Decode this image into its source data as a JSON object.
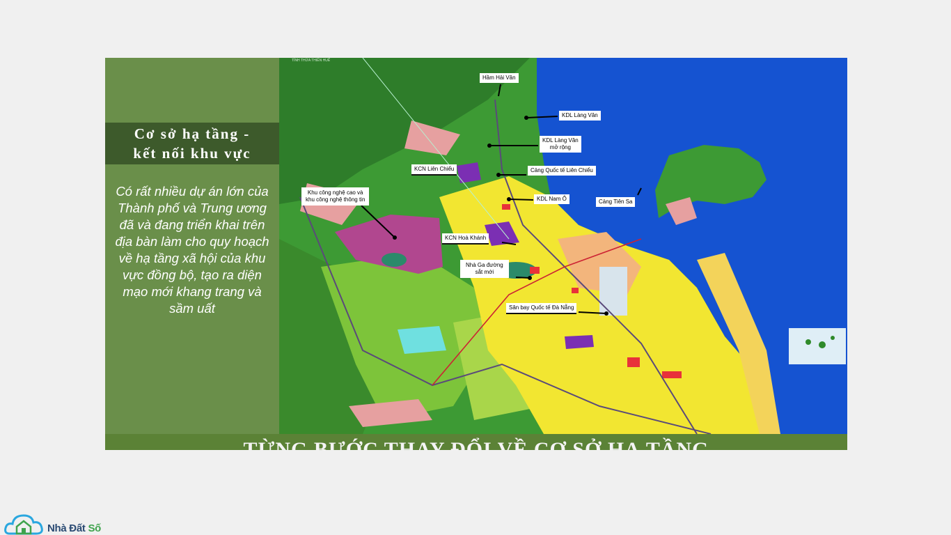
{
  "slide": {
    "title_line1": "Cơ sở hạ tầng -",
    "title_line2": "kết nối khu vực",
    "body": "Có rất nhiều dự án lớn của Thành phố và Trung ương đã và đang triển khai trên địa bàn làm cho quy hoạch về hạ tầng xã hội của khu vực đồng bộ, tạo ra diện mạo mới khang trang và sầm uất",
    "banner": "TỪNG BƯỚC THAY ĐỔI VỀ CƠ SỞ HẠ TẦNG"
  },
  "map": {
    "top_caption": "TỈNH THỪA THIÊN HUẾ",
    "labels": {
      "ham_hai_van": "Hầm Hải Vân",
      "kdl_lang_van": "KDL Làng Vân",
      "kdl_lang_van_mo_rong_1": "KDL Làng Vân",
      "kdl_lang_van_mo_rong_2": "mở rộng",
      "kcn_lien_chieu": "KCN Liên Chiểu",
      "cang_lien_chieu": "Cảng Quốc tế Liên Chiểu",
      "kdl_nam_o": "KDL Nam Ô",
      "cang_tien_sa": "Cảng Tiên Sa",
      "khu_cnc_1": "Khu công nghệ cao và",
      "khu_cnc_2": "khu công nghệ thông tin",
      "kcn_hoa_khanh": "KCN Hoà Khánh",
      "nha_ga_1": "Nhà Ga đường",
      "nha_ga_2": "sắt mới",
      "san_bay": "Sân bay Quốc tế Đà Nẵng"
    }
  },
  "logo": {
    "name_part1": "Nhà Đất ",
    "name_part2": "Số"
  },
  "colors": {
    "sidebar": "#6a8f4a",
    "title_box": "#3d5a2b",
    "banner": "#5b8236",
    "sea": "#1553d1",
    "forest": "#2f8a2a",
    "urban": "#f2e631"
  }
}
